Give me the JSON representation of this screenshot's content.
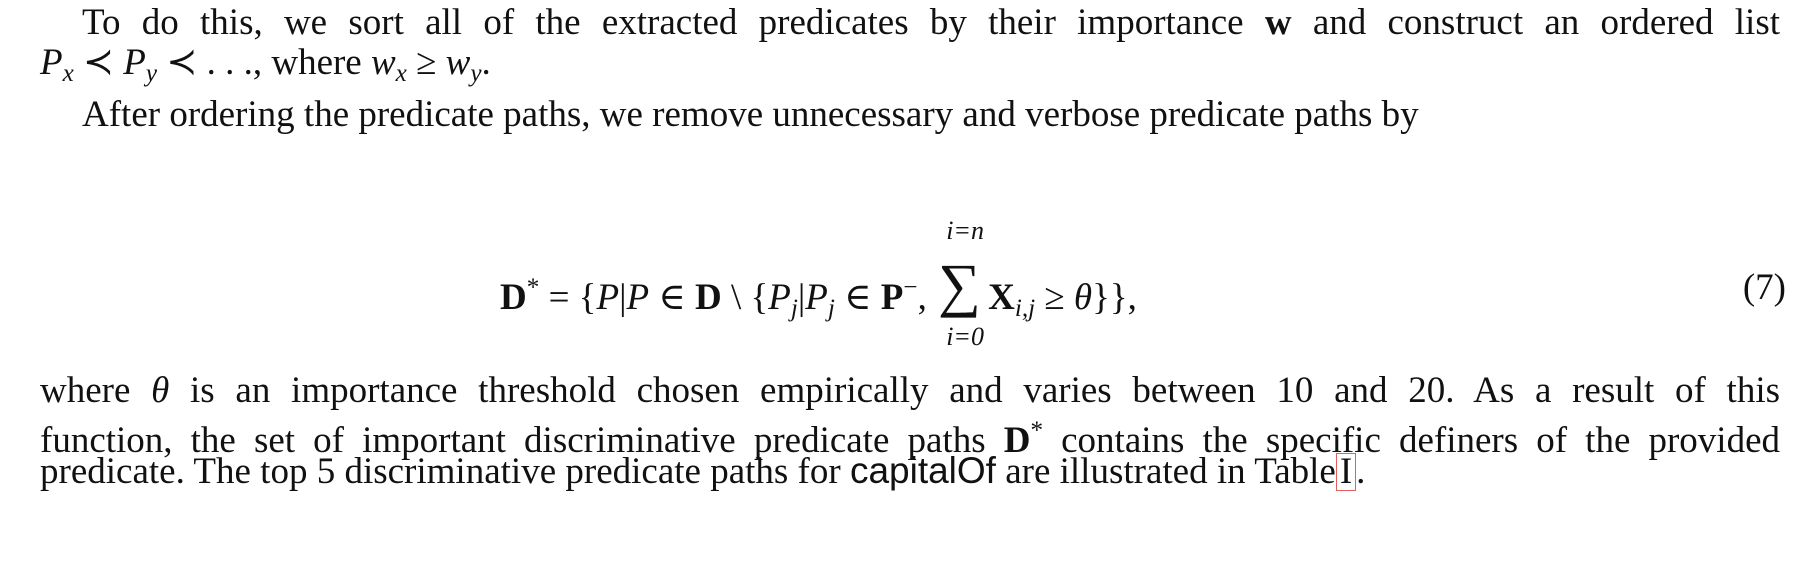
{
  "paragraph1": {
    "line1": "To do this, we sort all of the extracted predicates by their importance",
    "bold_w": "w",
    "line1_tail": "and construct an ordered list",
    "line2_tail": ", where"
  },
  "paragraph2": {
    "line1": "After ordering the predicate paths, we remove unnecessary and verbose predicate paths by"
  },
  "equation": {
    "number": "(7)",
    "sum_top": "i=n",
    "sum_bottom": "i=0"
  },
  "paragraph3": {
    "line1_a": "where",
    "line1_b": "is an importance threshold chosen empirically and varies between 10 and 20.  As a result of this",
    "line2_a": "function, the set of important discriminative predicate paths",
    "line2_b": "contains the specific definers of the provided",
    "line3_a": "predicate. The top 5 discriminative predicate paths for",
    "predicate_name": "capitalOf",
    "line3_b": "are illustrated in Table",
    "table_ref": "I",
    "line3_end": "."
  }
}
